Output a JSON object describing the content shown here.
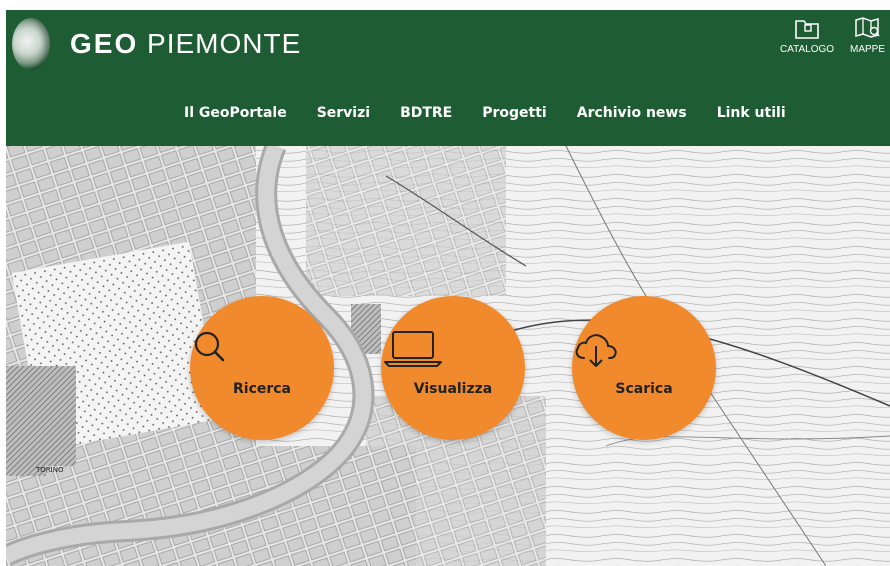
{
  "brand": {
    "logo_strong": "GEO",
    "logo_light": "PIEMONTE",
    "color_header": "#1e5c34",
    "color_accent": "#f08a2c"
  },
  "toolbar": {
    "catalogo": {
      "label": "CATALOGO",
      "icon": "folder-icon"
    },
    "mappe": {
      "label": "MAPPE",
      "icon": "map-icon"
    }
  },
  "nav": {
    "items": [
      {
        "label": "Il GeoPortale"
      },
      {
        "label": "Servizi"
      },
      {
        "label": "BDTRE"
      },
      {
        "label": "Progetti"
      },
      {
        "label": "Archivio news"
      },
      {
        "label": "Link utili"
      }
    ]
  },
  "hero": {
    "map_label": "TORINO",
    "actions": [
      {
        "label": "Ricerca",
        "icon": "magnifier-icon"
      },
      {
        "label": "Visualizza",
        "icon": "laptop-icon"
      },
      {
        "label": "Scarica",
        "icon": "cloud-download-icon"
      }
    ]
  }
}
